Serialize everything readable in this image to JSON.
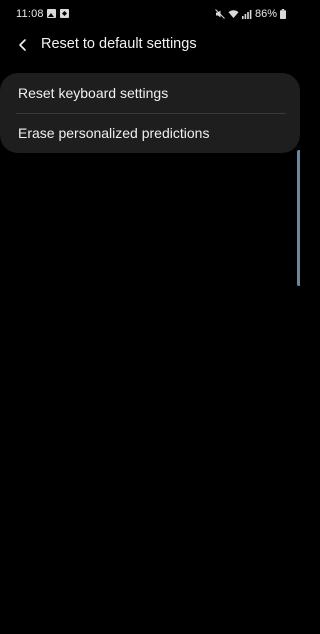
{
  "status_bar": {
    "time": "11:08",
    "battery_text": "86%"
  },
  "header": {
    "title": "Reset to default settings"
  },
  "options": [
    {
      "label": "Reset keyboard settings"
    },
    {
      "label": "Erase personalized predictions"
    }
  ],
  "colors": {
    "background": "#000000",
    "card": "#1e1e1e",
    "text": "#f0f0f0",
    "edge_hint": "#6f8599"
  },
  "icons": {
    "back": "chevron-left-icon",
    "gallery": "gallery-icon",
    "message": "message-icon",
    "mute": "mute-icon",
    "wifi": "wifi-icon",
    "signal": "signal-icon",
    "battery": "battery-icon"
  }
}
